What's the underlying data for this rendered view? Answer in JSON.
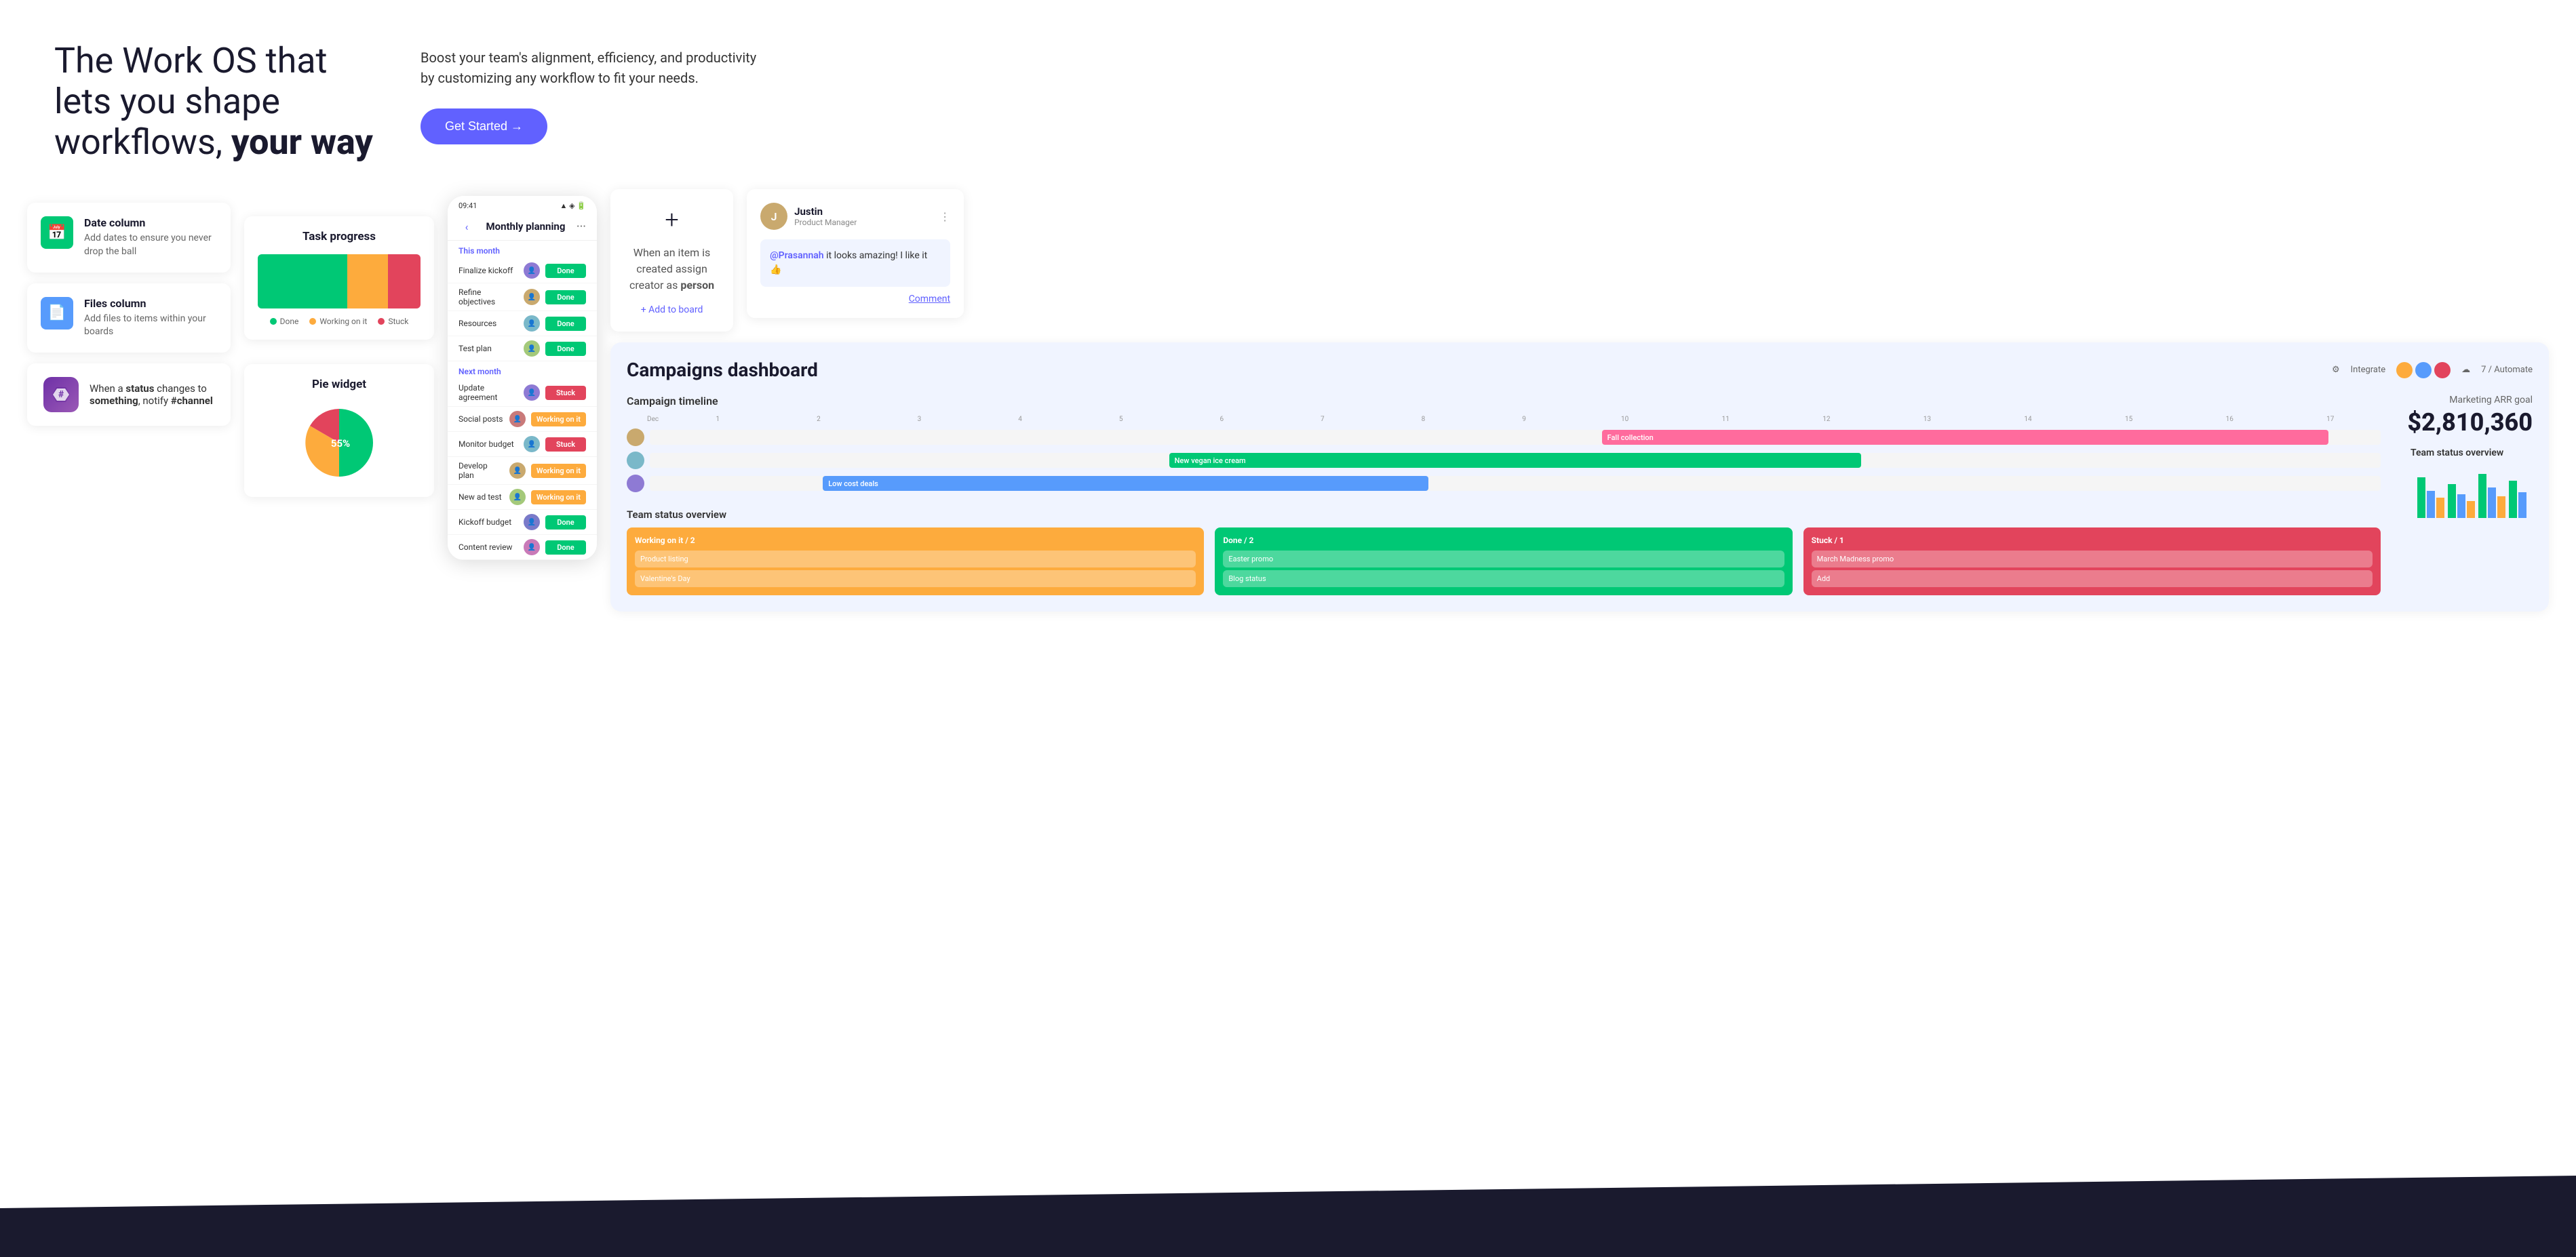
{
  "hero": {
    "title_normal": "The Work OS that lets you shape workflows,",
    "title_bold": "your way",
    "subtitle": "Boost your team's alignment, efficiency, and productivity by customizing any workflow to fit your needs.",
    "cta_label": "Get Started →"
  },
  "feature_cards": {
    "date": {
      "title": "Date column",
      "description": "Add dates to ensure you never drop the ball",
      "icon": "📅"
    },
    "files": {
      "title": "Files column",
      "description": "Add files to items within your boards",
      "icon": "📄"
    }
  },
  "automation": {
    "text_prefix": "When a",
    "status_word": "status",
    "text_mid": "changes to",
    "something_word": "something",
    "text_sep": ",",
    "notify_text": "notify",
    "channel_word": "#channel"
  },
  "task_progress": {
    "title": "Task progress",
    "bar_done_pct": 55,
    "bar_working_pct": 25,
    "bar_stuck_pct": 20,
    "colors": {
      "done": "#00c875",
      "working": "#fdab3d",
      "stuck": "#e2445c"
    },
    "legend": {
      "done": "Done",
      "working": "Working on it",
      "stuck": "Stuck"
    }
  },
  "pie_widget": {
    "title": "Pie widget",
    "label": "55%",
    "segments": [
      {
        "value": 55,
        "color": "#00c875",
        "label": "Done"
      },
      {
        "value": 25,
        "color": "#fdab3d",
        "label": "Working"
      },
      {
        "value": 20,
        "color": "#e2445c",
        "label": "Stuck"
      }
    ]
  },
  "phone": {
    "time": "09:41",
    "header_title": "Monthly planning",
    "section_this_month": "This month",
    "section_next_month": "Next month",
    "tasks": [
      {
        "name": "Finalize kickoff",
        "status": "Done",
        "status_type": "done"
      },
      {
        "name": "Refine objectives",
        "status": "Done",
        "status_type": "done"
      },
      {
        "name": "Resources",
        "status": "Done",
        "status_type": "done"
      },
      {
        "name": "Test plan",
        "status": "Done",
        "status_type": "done"
      },
      {
        "name": "Update agreement",
        "status": "Stuck",
        "status_type": "stuck"
      },
      {
        "name": "Social posts",
        "status": "Working on it",
        "status_type": "working"
      },
      {
        "name": "Monitor budget",
        "status": "Stuck",
        "status_type": "stuck"
      },
      {
        "name": "Develop plan",
        "status": "Working on it",
        "status_type": "working"
      },
      {
        "name": "New ad test",
        "status": "Working on it",
        "status_type": "working"
      },
      {
        "name": "Kickoff budget",
        "status": "Done",
        "status_type": "done"
      },
      {
        "name": "Content review",
        "status": "Done",
        "status_type": "done"
      }
    ]
  },
  "trigger_card": {
    "plus_icon": "+",
    "text_line1": "When an item is",
    "text_line2": "created assign",
    "text_line3_pre": "creator as ",
    "text_line3_bold": "person",
    "add_to_board": "+ Add to board"
  },
  "comment_card": {
    "user_name": "Justin",
    "user_role": "Product Manager",
    "mention": "@Prasannah",
    "comment_text": " it looks amazing! I like it 👍",
    "action": "Comment"
  },
  "dashboard": {
    "title": "Campaigns dashboard",
    "integrate_label": "Integrate",
    "automate_label": "7 / Automate",
    "timeline": {
      "title": "Campaign timeline",
      "months": [
        "Dec",
        "1",
        "2",
        "3",
        "4",
        "5",
        "6",
        "7",
        "8",
        "9",
        "10",
        "11",
        "12",
        "13",
        "14",
        "15",
        "16",
        "17"
      ],
      "bars": [
        {
          "label": "Fall collection",
          "color": "#ff6b9d",
          "left": "55%",
          "width": "35%"
        },
        {
          "label": "New vegan ice cream",
          "color": "#00c875",
          "left": "35%",
          "width": "30%"
        },
        {
          "label": "Low cost deals",
          "color": "#579bfc",
          "left": "20%",
          "width": "25%"
        }
      ]
    },
    "arr": {
      "label": "Marketing ARR goal",
      "value": "$2,810,360"
    },
    "team_status": {
      "title": "Team status overview",
      "working": {
        "label": "Working on it / 2",
        "items": [
          "Product listing",
          "Valentine's Day"
        ]
      },
      "done": {
        "label": "Done / 2",
        "items": [
          "Easter promo",
          "Blog status"
        ]
      },
      "stuck": {
        "label": "Stuck / 1",
        "items": [
          "March Madness promo",
          "Add"
        ]
      }
    }
  }
}
